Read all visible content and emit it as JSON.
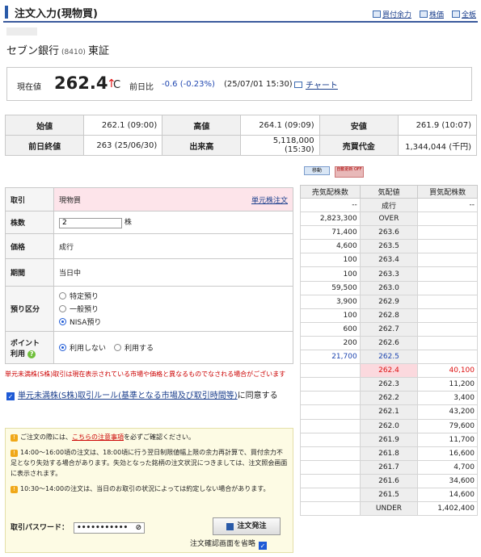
{
  "header": {
    "title": "注文入力(現物買)",
    "links": [
      "買付余力",
      "株価",
      "全板"
    ]
  },
  "stock": {
    "name": "セブン銀行",
    "code": "(8410)",
    "market": "東証"
  },
  "quote": {
    "label": "現在値",
    "price": "262.4",
    "arrow": "↑",
    "tick": "C",
    "change_label": "前日比",
    "change": "-0.6 (-0.23%)",
    "change_time": "(25/07/01 15:30)",
    "chart_link": "チャート"
  },
  "stats": [
    [
      {
        "h": "始値",
        "v": "262.1 (09:00)"
      },
      {
        "h": "高値",
        "v": "264.1 (09:09)"
      },
      {
        "h": "安値",
        "v": "261.9 (10:07)"
      }
    ],
    [
      {
        "h": "前日終値",
        "v": "263 (25/06/30)"
      },
      {
        "h": "出来高",
        "v": "5,118,000 (15:30)"
      },
      {
        "h": "売買代金",
        "v": "1,344,044 (千円)"
      }
    ]
  ],
  "board_buttons": {
    "move": "移動",
    "auto": "自動更新 OFF"
  },
  "form": {
    "trade_label": "取引",
    "trade_value": "現物買",
    "unit_link": "単元株注文",
    "qty_label": "株数",
    "qty_value": "2",
    "qty_unit": "株",
    "price_label": "価格",
    "price_value": "成行",
    "period_label": "期間",
    "period_value": "当日中",
    "account_label": "預り区分",
    "account_options": [
      "特定預り",
      "一般預り",
      "NISA預り"
    ],
    "account_selected": 2,
    "point_label1": "ポイント",
    "point_label2": "利用",
    "point_options": [
      "利用しない",
      "利用する"
    ],
    "point_selected": 0
  },
  "warning_red": "単元未満株(S株)取引は現在表示されている市場や価格と異なるものでなされる場合がございます",
  "agree": {
    "link": "単元未満株(S株)取引ルール(基準となる市場及び取引時間等)",
    "tail": "に同意する"
  },
  "notice": {
    "n1_pre": "ご注文の際には、",
    "n1_link": "こちらの注意事項",
    "n1_post": "を必ずご確認ください。",
    "n2": "14:00～16:00頃の注文は、18:00頃に行う翌日制限値幅上限の余力再計算で、買付余力不足となり失効する場合があります。失効となった銘柄の注文状況につきましては、注文照会画面に表示されます。",
    "n3": "10:30～14:00の注文は、当日のお取引の状況によっては約定しない場合があります。",
    "pw_label": "取引パスワード：",
    "pw_value": "•••••••••••",
    "submit": "注文発注",
    "skip": "注文確認画面を省略"
  },
  "board": {
    "headers": [
      "売気配株数",
      "気配値",
      "買気配株数"
    ],
    "rows": [
      {
        "ask": "--",
        "price": "成行",
        "bid": "--"
      },
      {
        "ask": "2,823,300",
        "price": "OVER",
        "bid": ""
      },
      {
        "ask": "71,400",
        "price": "263.6",
        "bid": ""
      },
      {
        "ask": "4,600",
        "price": "263.5",
        "bid": ""
      },
      {
        "ask": "100",
        "price": "263.4",
        "bid": ""
      },
      {
        "ask": "100",
        "price": "263.3",
        "bid": ""
      },
      {
        "ask": "59,500",
        "price": "263.0",
        "bid": ""
      },
      {
        "ask": "3,900",
        "price": "262.9",
        "bid": ""
      },
      {
        "ask": "100",
        "price": "262.8",
        "bid": ""
      },
      {
        "ask": "600",
        "price": "262.7",
        "bid": ""
      },
      {
        "ask": "200",
        "price": "262.6",
        "bid": ""
      },
      {
        "ask": "21,700",
        "price": "262.5",
        "bid": ""
      },
      {
        "ask": "",
        "price": "262.4",
        "bid": "40,100"
      },
      {
        "ask": "",
        "price": "262.3",
        "bid": "11,200"
      },
      {
        "ask": "",
        "price": "262.2",
        "bid": "3,400"
      },
      {
        "ask": "",
        "price": "262.1",
        "bid": "43,200"
      },
      {
        "ask": "",
        "price": "262.0",
        "bid": "79,600"
      },
      {
        "ask": "",
        "price": "261.9",
        "bid": "11,700"
      },
      {
        "ask": "",
        "price": "261.8",
        "bid": "16,600"
      },
      {
        "ask": "",
        "price": "261.7",
        "bid": "4,700"
      },
      {
        "ask": "",
        "price": "261.6",
        "bid": "34,600"
      },
      {
        "ask": "",
        "price": "261.5",
        "bid": "14,600"
      },
      {
        "ask": "",
        "price": "UNDER",
        "bid": "1,402,400"
      }
    ]
  }
}
